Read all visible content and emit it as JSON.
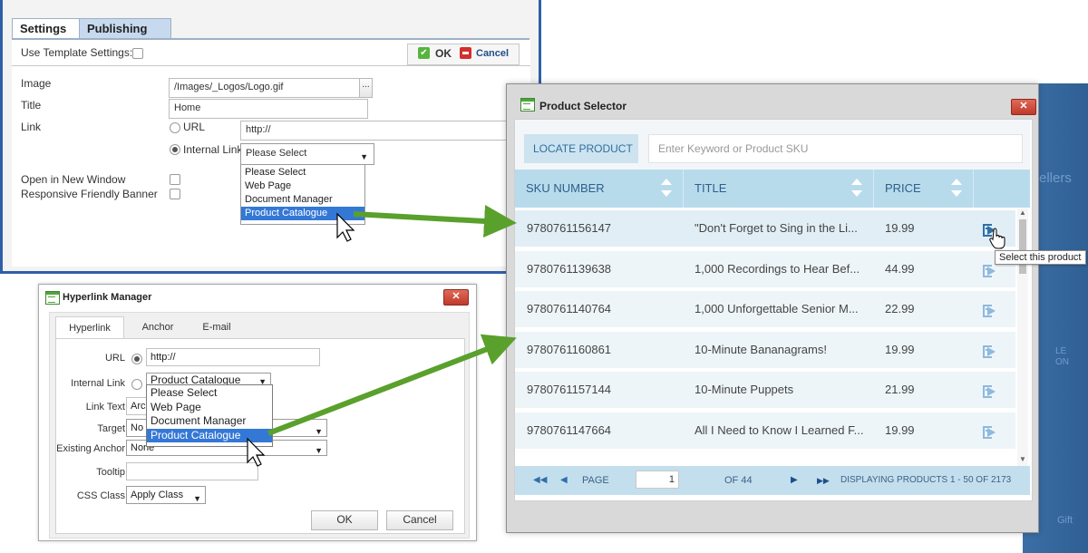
{
  "settings_dialog": {
    "tabs": [
      "Settings",
      "Publishing"
    ],
    "use_template_label": "Use Template Settings:",
    "ok_label": "OK",
    "cancel_label": "Cancel",
    "image_label": "Image",
    "image_value": "/Images/_Logos/Logo.gif",
    "browse_label": "...",
    "title_label": "Title",
    "title_value": "Home",
    "link_label": "Link",
    "url_option": "URL",
    "url_value": "http://",
    "internal_link_option": "Internal Link",
    "internal_select_value": "Please Select",
    "dropdown_options": [
      "Please Select",
      "Web Page",
      "Document Manager",
      "Product Catalogue"
    ],
    "dropdown_selected": "Product Catalogue",
    "open_new_window_label": "Open in New Window",
    "responsive_banner_label": "Responsive Friendly Banner"
  },
  "product_selector": {
    "title": "Product Selector",
    "close_label": "✕",
    "locate_label": "LOCATE PRODUCT",
    "search_placeholder": "Enter Keyword or Product SKU",
    "columns": [
      "SKU NUMBER",
      "TITLE",
      "PRICE"
    ],
    "rows": [
      {
        "sku": "9780761156147",
        "title": "\"Don't Forget to Sing in the Li...",
        "price": "19.99"
      },
      {
        "sku": "9780761139638",
        "title": "1,000 Recordings to Hear Bef...",
        "price": "44.99"
      },
      {
        "sku": "9780761140764",
        "title": "1,000 Unforgettable Senior M...",
        "price": "22.99"
      },
      {
        "sku": "9780761160861",
        "title": "10-Minute Bananagrams!",
        "price": "19.99"
      },
      {
        "sku": "9780761157144",
        "title": "10-Minute Puppets",
        "price": "21.99"
      },
      {
        "sku": "9780761147664",
        "title": "All I Need to Know I Learned F...",
        "price": "19.99"
      }
    ],
    "tooltip": "Select this product",
    "pager": {
      "page_label": "PAGE",
      "page_value": "1",
      "of_label": "OF 44",
      "display_label": "DISPLAYING PRODUCTS 1 - 50 OF 2173"
    }
  },
  "hyperlink_manager": {
    "title": "Hyperlink Manager",
    "close_label": "✕",
    "tabs": [
      "Hyperlink",
      "Anchor",
      "E-mail"
    ],
    "url_label": "URL",
    "url_value": "http://",
    "internal_link_label": "Internal Link",
    "internal_select_value": "Product Catalogue",
    "dropdown_options": [
      "Please Select",
      "Web Page",
      "Document Manager",
      "Product Catalogue"
    ],
    "dropdown_selected": "Product Catalogue",
    "link_text_label": "Link Text",
    "link_text_value": "Arc",
    "target_label": "Target",
    "target_value": "No",
    "existing_anchor_label": "Existing Anchor",
    "existing_anchor_value": "None",
    "tooltip_label": "Tooltip",
    "css_class_label": "CSS Class",
    "css_class_value": "Apply Class",
    "ok_label": "OK",
    "cancel_label": "Cancel"
  },
  "background_panel": {
    "ghost_texts": [
      "ellers",
      "LE",
      "ON",
      "Gift"
    ]
  },
  "colors": {
    "accent_blue": "#3478d6",
    "arrow_green": "#5aa02c",
    "header_blue": "#b8dbec",
    "close_red": "#c0392b"
  }
}
